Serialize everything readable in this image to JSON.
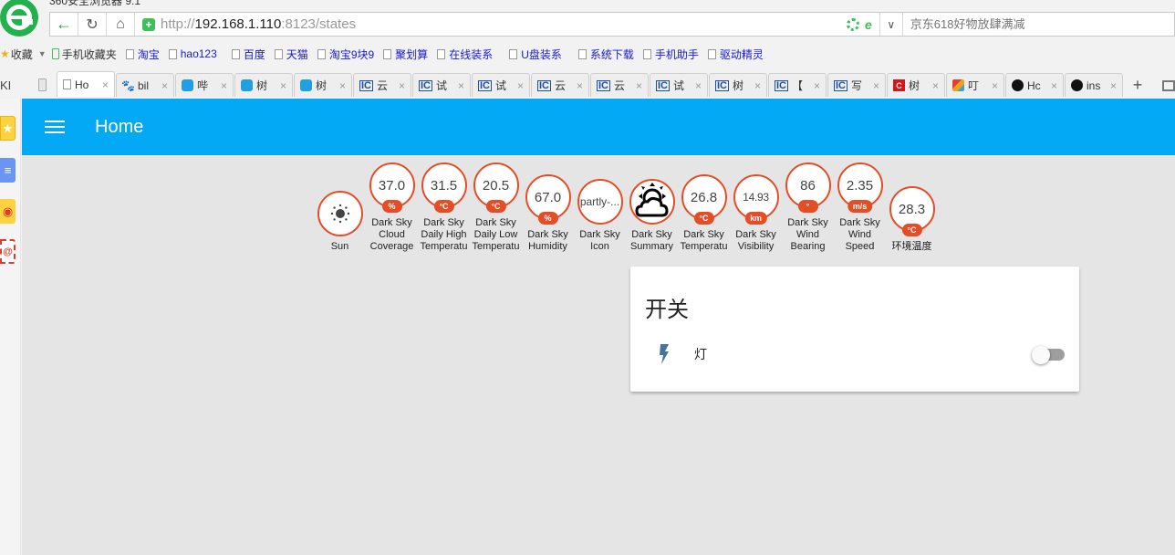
{
  "browser": {
    "window_title": "360安全浏览器 9.1",
    "address_bar": {
      "url_protocol": "http://",
      "url_host": "192.168.1.110",
      "url_rest": ":8123/states",
      "search_placeholder": "京东618好物放肆满减"
    },
    "bookmarks": [
      {
        "label": "收藏",
        "icon": "star-icon"
      },
      {
        "label": "手机收藏夹",
        "icon": "phone-icon"
      },
      {
        "label": "淘宝",
        "icon": "page-icon"
      },
      {
        "label": "hao123",
        "icon": "page-icon"
      },
      {
        "label": "百度",
        "icon": "page-icon"
      },
      {
        "label": "天猫",
        "icon": "page-icon"
      },
      {
        "label": "淘宝9块9",
        "icon": "page-icon"
      },
      {
        "label": "聚划算",
        "icon": "page-icon"
      },
      {
        "label": "在线装系",
        "icon": "page-icon"
      },
      {
        "label": "U盘装系",
        "icon": "page-icon"
      },
      {
        "label": "系统下载",
        "icon": "page-icon"
      },
      {
        "label": "手机助手",
        "icon": "page-icon"
      },
      {
        "label": "驱动精灵",
        "icon": "page-icon"
      }
    ],
    "tab_prefix": "KI",
    "tabs": [
      {
        "label": "Ho",
        "icon": "page",
        "active": true
      },
      {
        "label": "bil",
        "icon": "baidu"
      },
      {
        "label": "哔",
        "icon": "bili"
      },
      {
        "label": "树",
        "icon": "bili"
      },
      {
        "label": "树",
        "icon": "bili"
      },
      {
        "label": "云",
        "icon": "ic"
      },
      {
        "label": "试",
        "icon": "ic"
      },
      {
        "label": "试",
        "icon": "ic"
      },
      {
        "label": "云",
        "icon": "ic"
      },
      {
        "label": "云",
        "icon": "ic"
      },
      {
        "label": "试",
        "icon": "ic"
      },
      {
        "label": "树",
        "icon": "ic"
      },
      {
        "label": "【",
        "icon": "ic"
      },
      {
        "label": "写",
        "icon": "ic"
      },
      {
        "label": "树",
        "icon": "c"
      },
      {
        "label": "叮",
        "icon": "box"
      },
      {
        "label": "Hc",
        "icon": "github"
      },
      {
        "label": "ins",
        "icon": "github"
      }
    ],
    "tab_close_glyph": "×",
    "new_tab_glyph": "+"
  },
  "app": {
    "title": "Home",
    "badges": [
      {
        "value": "",
        "unit": "",
        "label": [
          "",
          "",
          "Sun"
        ],
        "icon": "sun-icon"
      },
      {
        "value": "37.0",
        "unit": "%",
        "label": [
          "Dark Sky",
          "Cloud",
          "Coverage"
        ]
      },
      {
        "value": "31.5",
        "unit": "°C",
        "label": [
          "Dark Sky",
          "Daily High",
          "Temperatu"
        ]
      },
      {
        "value": "20.5",
        "unit": "°C",
        "label": [
          "Dark Sky",
          "Daily Low",
          "Temperatu"
        ]
      },
      {
        "value": "67.0",
        "unit": "%",
        "label": [
          "",
          "Dark Sky",
          "Humidity"
        ]
      },
      {
        "value": "partly-...",
        "unit": "",
        "label": [
          "",
          "Dark Sky",
          "Icon"
        ]
      },
      {
        "value": "",
        "unit": "",
        "label": [
          "",
          "Dark Sky",
          "Summary"
        ],
        "icon": "partly-cloudy-icon"
      },
      {
        "value": "26.8",
        "unit": "°C",
        "label": [
          "",
          "Dark Sky",
          "Temperatu"
        ]
      },
      {
        "value": "14.93",
        "unit": "km",
        "label": [
          "",
          "Dark Sky",
          "Visibility"
        ]
      },
      {
        "value": "86",
        "unit": "°",
        "label": [
          "Dark Sky",
          "Wind",
          "Bearing"
        ]
      },
      {
        "value": "2.35",
        "unit": "m/s",
        "label": [
          "Dark Sky",
          "Wind",
          "Speed"
        ]
      },
      {
        "value": "28.3",
        "unit": "°C",
        "label": [
          "",
          "",
          "环境温度"
        ]
      }
    ],
    "card": {
      "title": "开关",
      "entities": [
        {
          "name": "灯",
          "icon": "flash-icon",
          "state": "off"
        }
      ]
    },
    "colors": {
      "toolbar": "#03a9f4",
      "badge_accent": "#e44d26",
      "icon_blue": "#44739e"
    }
  }
}
